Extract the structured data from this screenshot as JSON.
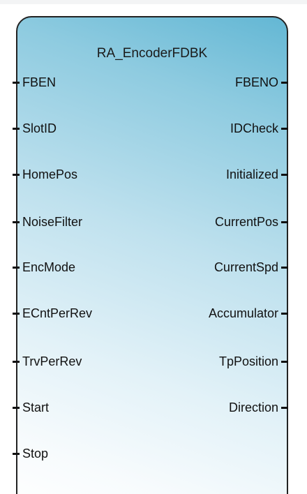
{
  "block": {
    "title": "RA_EncoderFDBK",
    "inputs": [
      "FBEN",
      "SlotID",
      "HomePos",
      "NoiseFilter",
      "EncMode",
      "ECntPerRev",
      "TrvPerRev",
      "Start",
      "Stop"
    ],
    "outputs": [
      "FBENO",
      "IDCheck",
      "Initialized",
      "CurrentPos",
      "CurrentSpd",
      "Accumulator",
      "TpPosition",
      "Direction"
    ]
  },
  "colors": {
    "gradient_top_right": "#63b7d4",
    "gradient_bottom_left": "#ffffff",
    "border": "#222222",
    "text": "#111111"
  }
}
